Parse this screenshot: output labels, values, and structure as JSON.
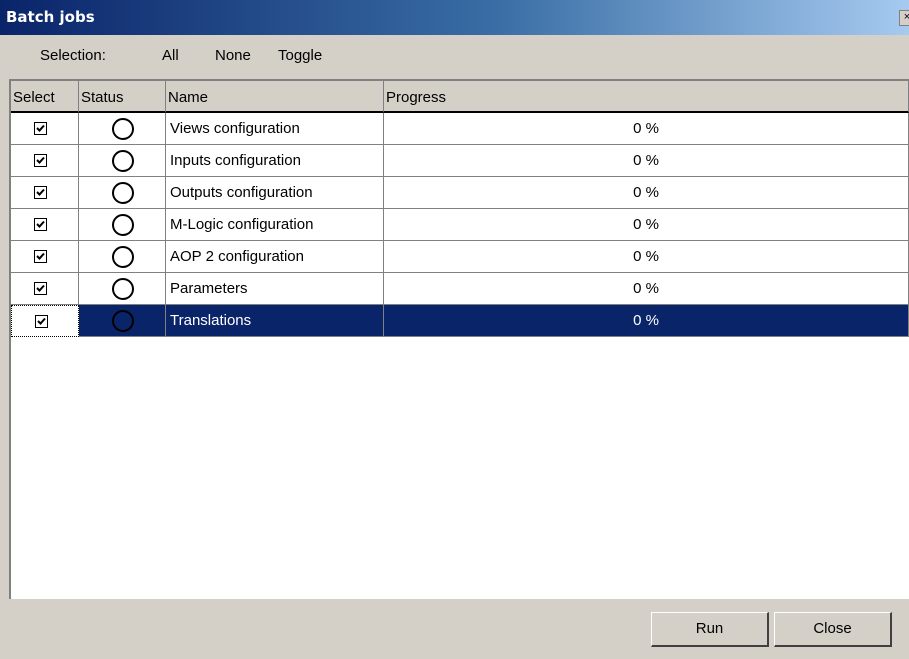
{
  "window": {
    "title": "Batch jobs",
    "close_glyph": "×"
  },
  "selection": {
    "label": "Selection:",
    "all": "All",
    "none": "None",
    "toggle": "Toggle"
  },
  "columns": {
    "select": "Select",
    "status": "Status",
    "name": "Name",
    "progress": "Progress"
  },
  "jobs": [
    {
      "checked": true,
      "name": "Views configuration",
      "progress": "0 %"
    },
    {
      "checked": true,
      "name": "Inputs configuration",
      "progress": "0 %"
    },
    {
      "checked": true,
      "name": "Outputs configuration",
      "progress": "0 %"
    },
    {
      "checked": true,
      "name": "M-Logic configuration",
      "progress": "0 %"
    },
    {
      "checked": true,
      "name": "AOP 2 configuration",
      "progress": "0 %"
    },
    {
      "checked": true,
      "name": "Parameters",
      "progress": "0 %"
    },
    {
      "checked": true,
      "name": "Translations",
      "progress": "0 %",
      "selected": true
    }
  ],
  "buttons": {
    "run": "Run",
    "close": "Close"
  },
  "icons": {
    "checkbox": "checkmark-icon",
    "status": "status-circle-icon",
    "close": "close-icon"
  },
  "colors": {
    "title_start": "#0a246a",
    "title_end": "#a6caf0",
    "selection": "#0a246a",
    "face": "#d4d0c8"
  }
}
